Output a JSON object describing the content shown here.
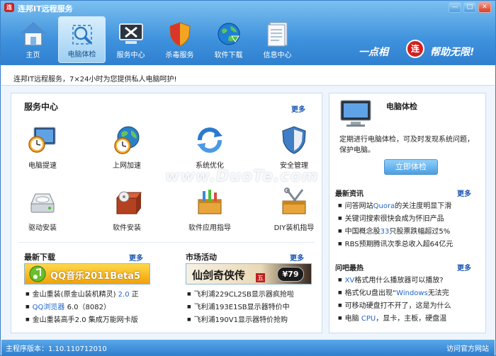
{
  "window": {
    "title": "连邦IT远程服务",
    "buttons": [
      "—",
      "□",
      "✕"
    ]
  },
  "toolbar": [
    {
      "label": "主页",
      "icon": "home-icon"
    },
    {
      "label": "电脑体检",
      "icon": "magnifier-icon"
    },
    {
      "label": "服务中心",
      "icon": "tools-monitor-icon"
    },
    {
      "label": "杀毒服务",
      "icon": "shield-icon"
    },
    {
      "label": "软件下载",
      "icon": "globe-download-icon"
    },
    {
      "label": "信息中心",
      "icon": "document-icon"
    }
  ],
  "slogan": {
    "left": "一点相",
    "logo": "连",
    "right": "帮助无限!"
  },
  "notice": "连邦IT远程服务，7×24小时为您提供私人电脑呵护!",
  "service_center": {
    "title": "服务中心",
    "more": "更多",
    "items": [
      {
        "label": "电脑提速",
        "icon": "clock-monitor-icon"
      },
      {
        "label": "上网加速",
        "icon": "globe-clock-icon"
      },
      {
        "label": "系统优化",
        "icon": "refresh-icon"
      },
      {
        "label": "安全管理",
        "icon": "shield-icon"
      },
      {
        "label": "驱动安装",
        "icon": "drive-icon"
      },
      {
        "label": "软件安装",
        "icon": "box-install-icon"
      },
      {
        "label": "软件应用指导",
        "icon": "toolbox-icon"
      },
      {
        "label": "DIY装机指导",
        "icon": "diy-tools-icon"
      }
    ]
  },
  "downloads": {
    "title": "最新下载",
    "more": "更多",
    "banner": "QQ音乐2011Beta5",
    "items": [
      {
        "text": "金山重装(原金山装机精灵) ",
        "accent": "2.0",
        "tail": " 正"
      },
      {
        "text": "",
        "accent": "QQ浏览器",
        "tail": " 6.0（8082）"
      },
      {
        "text": "金山重装高手2.0 集成万能网卡版",
        "accent": "",
        "tail": ""
      }
    ]
  },
  "market": {
    "title": "市场活动",
    "more": "更多",
    "banner": {
      "main": "仙剑奇侠传",
      "tag": "五",
      "price": "¥79"
    },
    "items": [
      "飞利浦229CL2SB显示器疯抢啦",
      "飞利浦193E1SB显示器特价中",
      "飞利浦190V1显示器特价抢购"
    ]
  },
  "checkup": {
    "title": "电脑体检",
    "desc": "定期进行电脑体检，可及时发现系统问题，保护电脑。",
    "button": "立即体检"
  },
  "news": {
    "title": "最新资讯",
    "more": "更多",
    "items": [
      {
        "a": "问答网站",
        "b": "Quora",
        "c": "的关注度明显下滑"
      },
      {
        "a": "关键词搜索很快会成为怀旧产品",
        "b": "",
        "c": ""
      },
      {
        "a": "中国概念股",
        "b": "33",
        "c": "只股票跌幅超过5%"
      },
      {
        "a": "RBS预期腾讯次季总收入超64亿元",
        "b": "",
        "c": ""
      }
    ]
  },
  "faq": {
    "title": "问吧最热",
    "more": "更多",
    "items": [
      {
        "a": "",
        "b": "XV",
        "c": "格式用什么播放器可以播放?"
      },
      {
        "a": "格式化U盘出现“",
        "b": "Windows",
        "c": "无法完"
      },
      {
        "a": "可移动硬盘打不开了，这是为什么",
        "b": "",
        "c": ""
      },
      {
        "a": "电脑 ",
        "b": "CPU",
        "c": "，显卡，主板，硬盘温"
      }
    ]
  },
  "watermark": "www.DuoTe.com",
  "status": {
    "version": "主程序版本：1.10.110712010",
    "visit": "访问官方网站"
  },
  "colors": {
    "header": "#3f92dd",
    "accent_blue": "#1a55b0",
    "brand_red": "#d21f1f"
  }
}
